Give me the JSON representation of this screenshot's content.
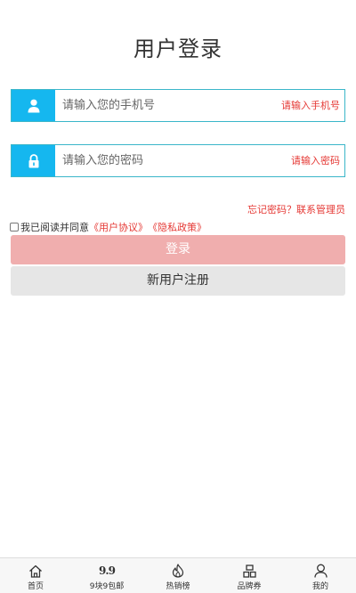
{
  "page": {
    "title": "用户登录"
  },
  "phone_field": {
    "icon": "user-icon",
    "placeholder": "请输入您的手机号",
    "hint": "请输入手机号"
  },
  "password_field": {
    "icon": "lock-icon",
    "placeholder": "请输入您的密码",
    "hint": "请输入密码"
  },
  "forgot": {
    "text": "忘记密码？联系管理员"
  },
  "agreement": {
    "checked": false,
    "prefix": "我已阅读并同意",
    "user_agreement": "《用户协议》",
    "privacy_policy": "《隐私政策》"
  },
  "buttons": {
    "login": "登录",
    "register": "新用户注册"
  },
  "tabbar": {
    "items": [
      {
        "label": "首页",
        "icon": "home-icon"
      },
      {
        "label": "9块9包邮",
        "icon": "nine-nine-icon",
        "icon_text": "9.9"
      },
      {
        "label": "热销榜",
        "icon": "fire-icon"
      },
      {
        "label": "品牌券",
        "icon": "brand-icon"
      },
      {
        "label": "我的",
        "icon": "profile-icon"
      }
    ]
  },
  "colors": {
    "accent": "#15b7ef",
    "border": "#3ab6c9",
    "hint_red": "#e53935",
    "login_button": "#f0aeae",
    "register_button": "#e6e6e6"
  }
}
